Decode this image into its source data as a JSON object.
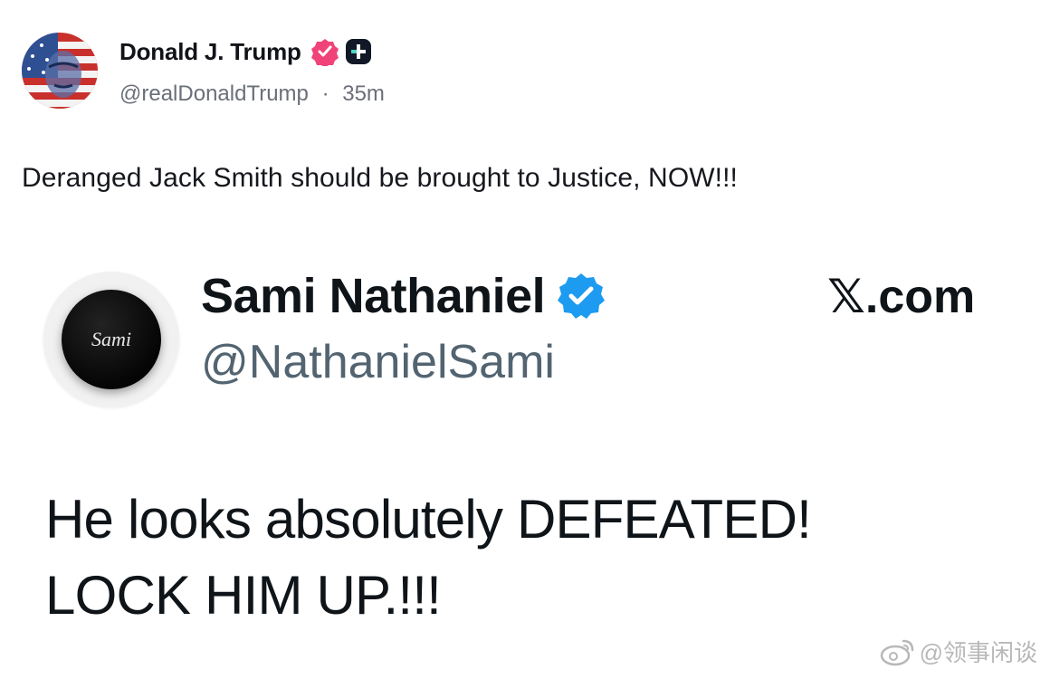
{
  "post": {
    "author_name": "Donald J. Trump",
    "handle": "@realDonaldTrump",
    "separator": "·",
    "time": "35m",
    "text": "Deranged Jack Smith should be brought to Justice, NOW!!!",
    "colors": {
      "verified_badge": "#f0437a",
      "plus_badge": "#111827"
    }
  },
  "embed": {
    "avatar_text": "Sami",
    "author_name": "Sami Nathaniel",
    "handle": "@NathanielSami",
    "site": "𝕏.com",
    "body_line1": "He looks absolutely DEFEATED!",
    "body_line2": "LOCK HIM UP.!!!",
    "colors": {
      "verified_badge": "#1d9bf0"
    }
  },
  "watermark": {
    "text": "@领事闲谈"
  }
}
